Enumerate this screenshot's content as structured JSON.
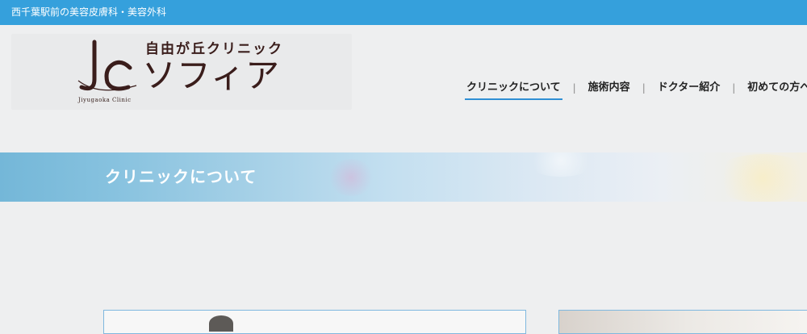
{
  "topbar": {
    "tagline": "西千葉駅前の美容皮膚科・美容外科"
  },
  "logo": {
    "mark": "Jc",
    "small_text": "Jiyugaoka Clinic",
    "line1": "自由が丘クリニック",
    "line2": "ソフィア"
  },
  "nav": {
    "items": [
      {
        "label": "クリニックについて",
        "active": true
      },
      {
        "label": "施術内容"
      },
      {
        "label": "ドクター紹介"
      },
      {
        "label": "初めての方へ"
      }
    ],
    "separator": "|"
  },
  "banner": {
    "title": "クリニックについて"
  },
  "colors": {
    "topbar": "#35a0dc",
    "nav_active_underline": "#2f8fd4",
    "logo_text": "#3a1d1b",
    "page_background": "#eeeff0"
  }
}
